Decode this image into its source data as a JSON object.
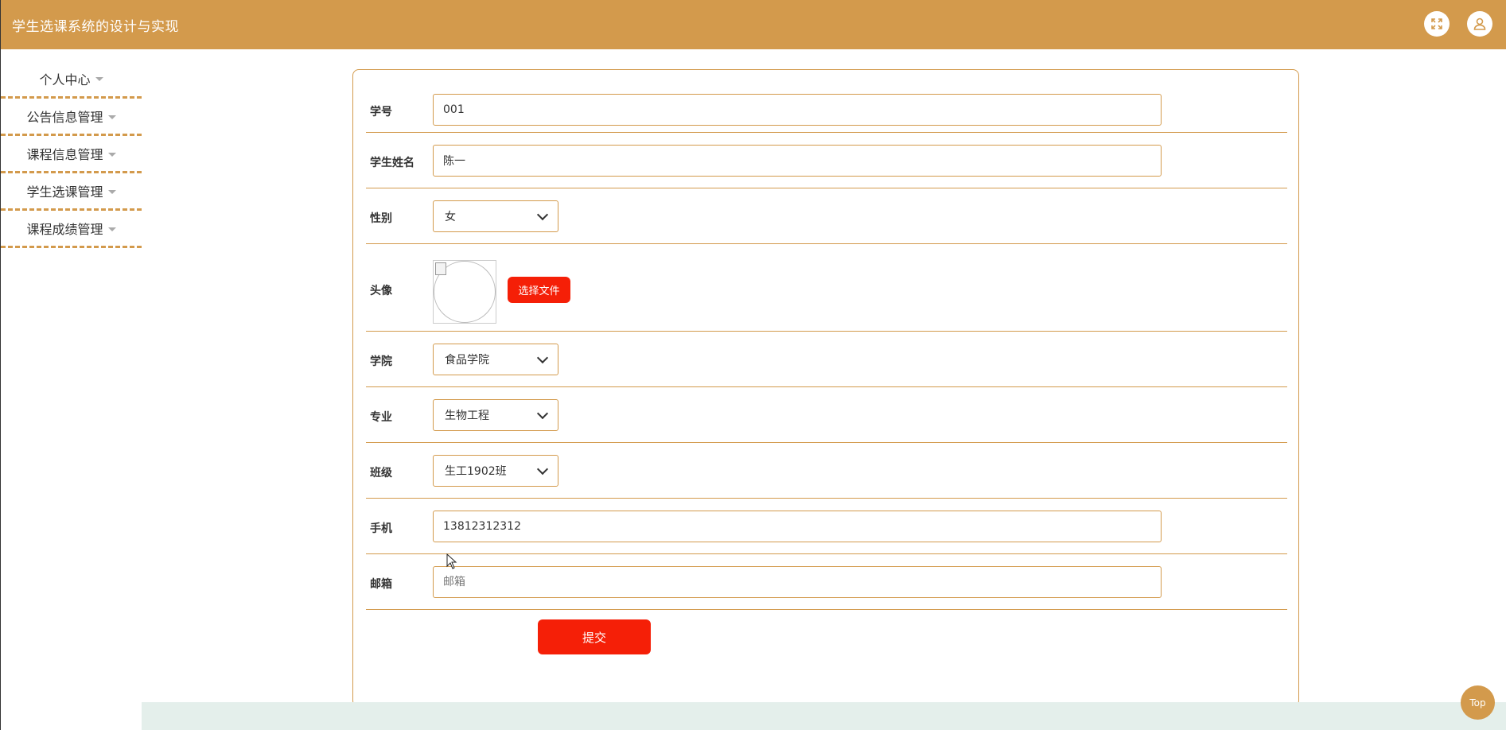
{
  "header": {
    "title": "学生选课系统的设计与实现",
    "icons": [
      "fullscreen-icon",
      "user-icon"
    ]
  },
  "sidebar": {
    "items": [
      {
        "label": "个人中心"
      },
      {
        "label": "公告信息管理"
      },
      {
        "label": "课程信息管理"
      },
      {
        "label": "学生选课管理"
      },
      {
        "label": "课程成绩管理"
      }
    ]
  },
  "form": {
    "student_no": {
      "label": "学号",
      "value": "001"
    },
    "name": {
      "label": "学生姓名",
      "value": "陈一"
    },
    "gender": {
      "label": "性别",
      "value": "女"
    },
    "avatar": {
      "label": "头像",
      "button": "选择文件"
    },
    "college": {
      "label": "学院",
      "value": "食品学院"
    },
    "major": {
      "label": "专业",
      "value": "生物工程"
    },
    "class": {
      "label": "班级",
      "value": "生工1902班"
    },
    "phone": {
      "label": "手机",
      "value": "13812312312"
    },
    "email": {
      "label": "邮箱",
      "value": "",
      "placeholder": "邮箱"
    },
    "submit": "提交"
  },
  "top_button": "Top",
  "colors": {
    "accent": "#d39a4c",
    "button": "#f51f07",
    "strip": "#e4efeb"
  }
}
